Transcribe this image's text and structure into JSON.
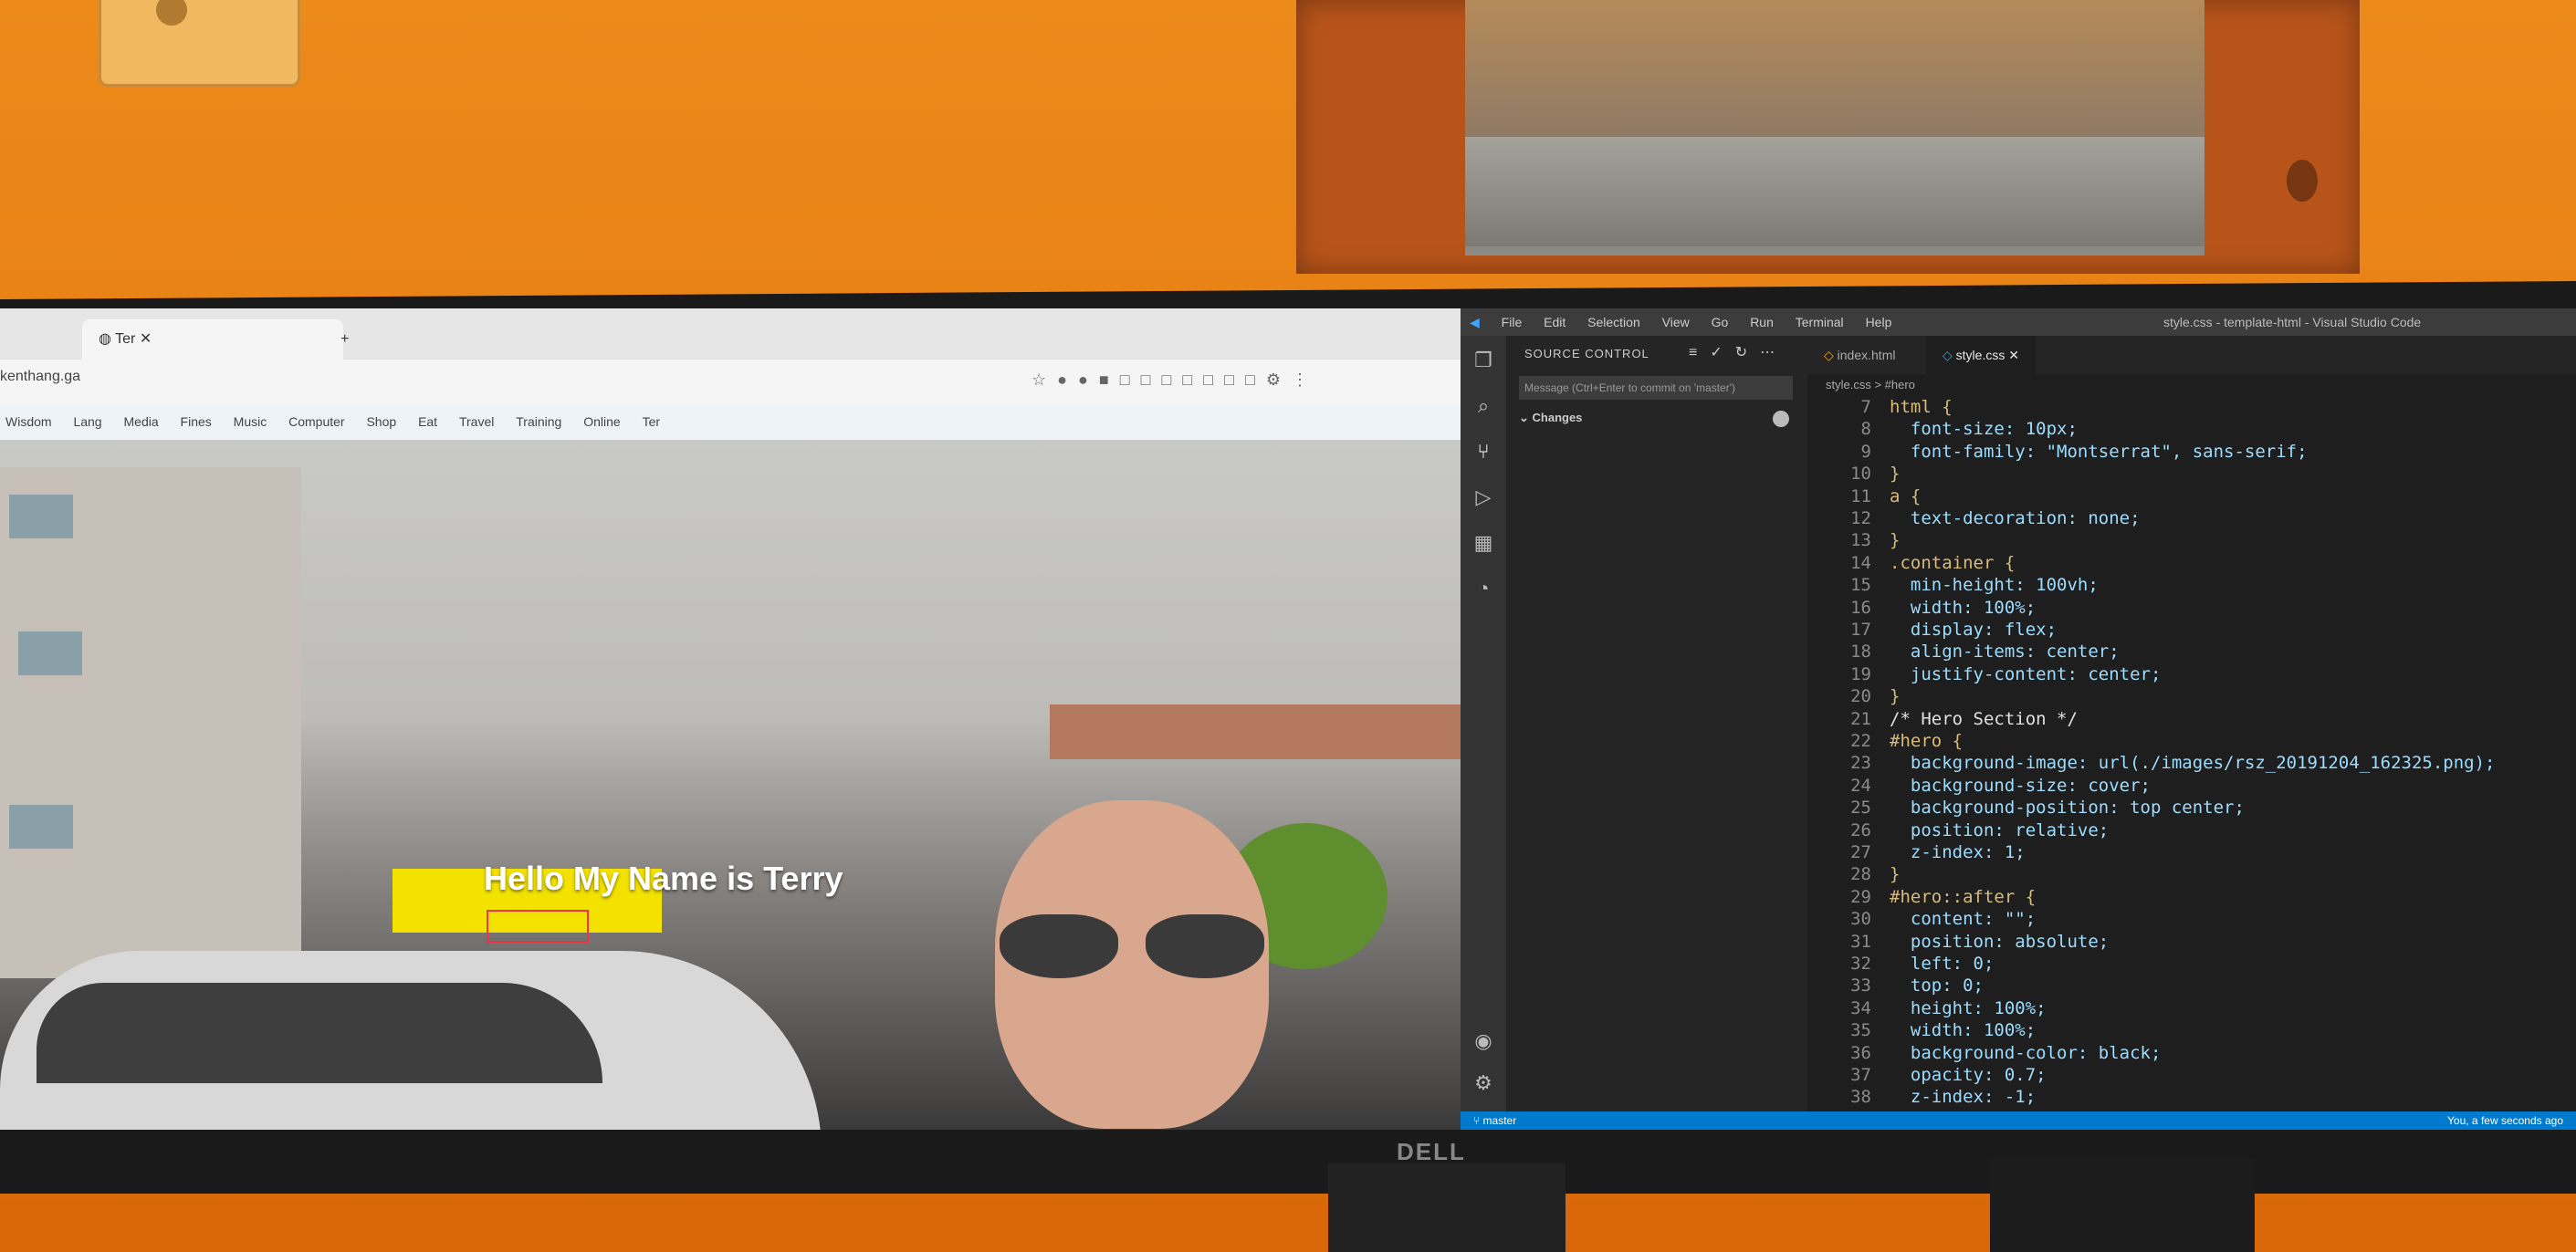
{
  "monitor": {
    "brand": "DELL"
  },
  "browser": {
    "tab_label": "Ter",
    "address": "kenthang.ga",
    "bookmarks": [
      "Wisdom",
      "Lang",
      "Media",
      "Fines",
      "Music",
      "Computer",
      "Shop",
      "Eat",
      "Travel",
      "Training",
      "Online",
      "Ter"
    ],
    "hero_title": "Hello My Name is Terry"
  },
  "vscode": {
    "menu": [
      "File",
      "Edit",
      "Selection",
      "View",
      "Go",
      "Run",
      "Terminal",
      "Help"
    ],
    "window_title": "style.css - template-html - Visual Studio Code",
    "sidebar": {
      "header": "SOURCE CONTROL",
      "message_placeholder": "Message (Ctrl+Enter to commit on 'master')",
      "changes_label": "Changes"
    },
    "tabs": [
      "index.html",
      "style.css"
    ],
    "breadcrumb": "style.css > #hero",
    "code_lines": [
      {
        "n": "7",
        "t": "html {"
      },
      {
        "n": "8",
        "t": "  font-size: 10px;"
      },
      {
        "n": "9",
        "t": "  font-family: \"Montserrat\", sans-serif;"
      },
      {
        "n": "10",
        "t": "}"
      },
      {
        "n": "11",
        "t": "a {"
      },
      {
        "n": "12",
        "t": "  text-decoration: none;"
      },
      {
        "n": "13",
        "t": "}"
      },
      {
        "n": "14",
        "t": ".container {"
      },
      {
        "n": "15",
        "t": "  min-height: 100vh;"
      },
      {
        "n": "16",
        "t": "  width: 100%;"
      },
      {
        "n": "17",
        "t": "  display: flex;"
      },
      {
        "n": "18",
        "t": "  align-items: center;"
      },
      {
        "n": "19",
        "t": "  justify-content: center;"
      },
      {
        "n": "20",
        "t": "}"
      },
      {
        "n": "21",
        "t": "/* Hero Section */"
      },
      {
        "n": "22",
        "t": "#hero {"
      },
      {
        "n": "23",
        "t": "  background-image: url(./images/rsz_20191204_162325.png);"
      },
      {
        "n": "24",
        "t": "  background-size: cover;"
      },
      {
        "n": "25",
        "t": "  background-position: top center;"
      },
      {
        "n": "26",
        "t": "  position: relative;"
      },
      {
        "n": "27",
        "t": "  z-index: 1;"
      },
      {
        "n": "28",
        "t": "}"
      },
      {
        "n": "29",
        "t": "#hero::after {"
      },
      {
        "n": "30",
        "t": "  content: \"\";"
      },
      {
        "n": "31",
        "t": "  position: absolute;"
      },
      {
        "n": "32",
        "t": "  left: 0;"
      },
      {
        "n": "33",
        "t": "  top: 0;"
      },
      {
        "n": "34",
        "t": "  height: 100%;"
      },
      {
        "n": "35",
        "t": "  width: 100%;"
      },
      {
        "n": "36",
        "t": "  background-color: black;"
      },
      {
        "n": "37",
        "t": "  opacity: 0.7;"
      },
      {
        "n": "38",
        "t": "  z-index: -1;"
      }
    ],
    "status": {
      "branch": "master",
      "right": "You, a few seconds ago"
    }
  }
}
